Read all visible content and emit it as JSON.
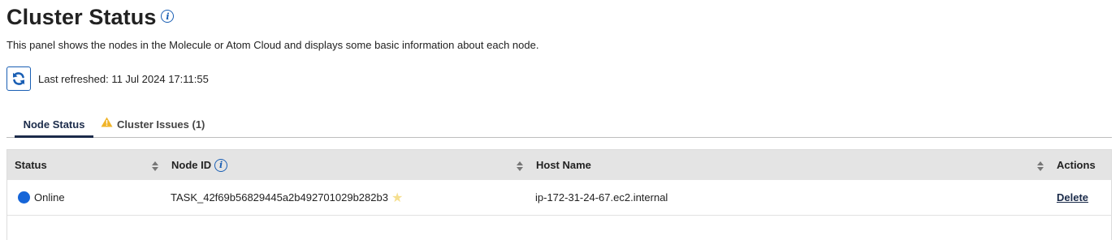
{
  "header": {
    "title": "Cluster Status",
    "description": "This panel shows the nodes in the Molecule or Atom Cloud and displays some basic information about each node.",
    "info_icon": "info-icon"
  },
  "refresh": {
    "icon": "refresh-icon",
    "last_refreshed": "Last refreshed: 11 Jul 2024 17:11:55"
  },
  "tabs": [
    {
      "label": "Node Status",
      "active": true
    },
    {
      "label": "Cluster Issues (1)",
      "icon": "warning-icon",
      "active": false
    }
  ],
  "table": {
    "columns": [
      "Status",
      "Node ID",
      "Host Name",
      "Actions"
    ],
    "rows": [
      {
        "status": "Online",
        "node_id": "TASK_42f69b56829445a2b492701029b282b3",
        "host_name": "ip-172-31-24-67.ec2.internal",
        "action": "Delete"
      }
    ]
  },
  "colors": {
    "accent": "#1a5fb4",
    "status_online": "#1565d8",
    "warning": "#f0b429",
    "header_bg": "#e4e4e4"
  }
}
